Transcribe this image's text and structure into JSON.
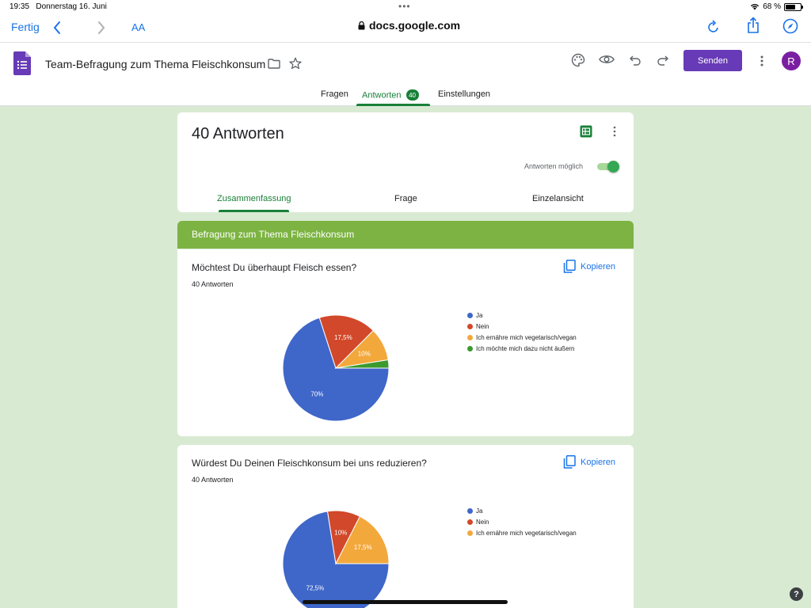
{
  "status_bar": {
    "time": "19:35",
    "date": "Donnerstag 16. Juni",
    "battery": "68 %",
    "battery_level": 0.68
  },
  "browser": {
    "done_label": "Fertig",
    "text_size_label": "AA",
    "url": "docs.google.com"
  },
  "header": {
    "doc_title": "Team-Befragung zum Thema Fleischkonsum",
    "send_label": "Senden",
    "avatar_initial": "R",
    "tabs": [
      {
        "label": "Fragen"
      },
      {
        "label": "Antworten",
        "badge": "40"
      },
      {
        "label": "Einstellungen"
      }
    ]
  },
  "summary": {
    "title": "40 Antworten",
    "accepting_label": "Antworten möglich",
    "accepting": true,
    "tabs": [
      "Zusammenfassung",
      "Frage",
      "Einzelansicht"
    ]
  },
  "section": {
    "title": "Befragung zum Thema Fleischkonsum"
  },
  "questions": [
    {
      "title": "Möchtest Du überhaupt Fleisch essen?",
      "count": "40 Antworten",
      "copy_label": "Kopieren"
    },
    {
      "title": "Würdest Du Deinen Fleischkonsum bei uns reduzieren?",
      "count": "40 Antworten",
      "copy_label": "Kopieren"
    }
  ],
  "colors": {
    "blue": "#3f67c9",
    "red": "#d2482a",
    "orange": "#f3a83b",
    "green": "#3c9a2f",
    "purple": "#673ab7",
    "accent_green": "#188038"
  },
  "chart_data": [
    {
      "type": "pie",
      "title": "Möchtest Du überhaupt Fleisch essen?",
      "labels": [
        "Ja",
        "Nein",
        "Ich ernähre mich vegetarisch/vegan",
        "Ich möchte mich dazu nicht äußern"
      ],
      "values": [
        70,
        17.5,
        10,
        2.5
      ],
      "display_labels": [
        "70%",
        "17,5%",
        "10%",
        ""
      ],
      "colors": [
        "#3f67c9",
        "#d2482a",
        "#f3a83b",
        "#3c9a2f"
      ],
      "legend": "right"
    },
    {
      "type": "pie",
      "title": "Würdest Du Deinen Fleischkonsum bei uns reduzieren?",
      "labels": [
        "Ja",
        "Nein",
        "Ich ernähre mich vegetarisch/vegan"
      ],
      "values": [
        72.5,
        10,
        17.5
      ],
      "display_labels": [
        "72,5%",
        "10%",
        "17,5%"
      ],
      "colors": [
        "#3f67c9",
        "#d2482a",
        "#f3a83b"
      ],
      "legend": "right"
    }
  ]
}
